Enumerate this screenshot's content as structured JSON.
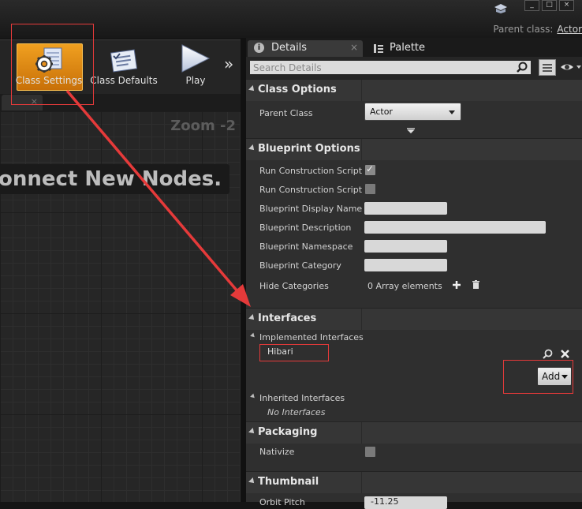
{
  "titlebar": {
    "window_buttons": [
      "_",
      "□",
      "×"
    ],
    "parent_class_label": "Parent class:",
    "parent_class_value": "Actor"
  },
  "toolbar": {
    "class_settings_label": "Class Settings",
    "class_defaults_label": "Class Defaults",
    "play_label": "Play",
    "more_label": "»"
  },
  "graph": {
    "zoom": "Zoom -2",
    "hint": "onnect New Nodes."
  },
  "panel": {
    "tabs": [
      {
        "label": "Details",
        "icon": "info-icon"
      },
      {
        "label": "Palette",
        "icon": "palette-icon"
      }
    ],
    "search_placeholder": "Search Details",
    "class_options": {
      "title": "Class Options",
      "parent_class_label": "Parent Class",
      "parent_class_value": "Actor"
    },
    "blueprint_options": {
      "title": "Blueprint Options",
      "rows": [
        {
          "label": "Run Construction Script o",
          "type": "checkbox",
          "checked": true
        },
        {
          "label": "Run Construction Script ir",
          "type": "checkbox",
          "checked": false
        },
        {
          "label": "Blueprint Display Name",
          "type": "text",
          "value": ""
        },
        {
          "label": "Blueprint Description",
          "type": "text",
          "value": ""
        },
        {
          "label": "Blueprint Namespace",
          "type": "text",
          "value": ""
        },
        {
          "label": "Blueprint Category",
          "type": "text",
          "value": ""
        },
        {
          "label": "Hide Categories",
          "type": "array",
          "value": "0 Array elements"
        }
      ]
    },
    "interfaces": {
      "title": "Interfaces",
      "implemented_label": "Implemented Interfaces",
      "implemented_items": [
        "Hibari"
      ],
      "add_label": "Add",
      "inherited_label": "Inherited Interfaces",
      "inherited_empty": "No Interfaces"
    },
    "packaging": {
      "title": "Packaging",
      "nativize_label": "Nativize",
      "nativize_checked": false
    },
    "thumbnail": {
      "title": "Thumbnail",
      "orbit_pitch_label": "Orbit Pitch",
      "orbit_pitch_value": "-11.25"
    }
  },
  "colors": {
    "accent_orange": "#e8901a",
    "annotation_red": "#e53a3a"
  }
}
